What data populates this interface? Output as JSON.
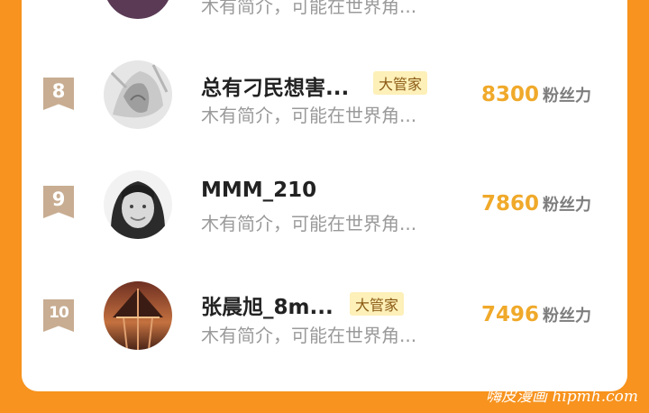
{
  "rows": [
    {
      "bio": "木有简介，可能在世界角..."
    },
    {
      "rank": "8",
      "name": "总有刁民想害...",
      "badge": "大管家",
      "bio": "木有简介，可能在世界角...",
      "fans": "8300",
      "fans_unit": "粉丝力",
      "avatar_icon": "grey-sketch-avatar"
    },
    {
      "rank": "9",
      "name": "MMM_210",
      "bio": "木有简介，可能在世界角...",
      "fans": "7860",
      "fans_unit": "粉丝力",
      "avatar_icon": "woman-photo-avatar"
    },
    {
      "rank": "10",
      "name": "张晨旭_8m...",
      "badge": "大管家",
      "bio": "木有简介，可能在世界角...",
      "fans": "7496",
      "fans_unit": "粉丝力",
      "avatar_icon": "tower-photo-avatar"
    }
  ],
  "watermark": "嗨皮漫画 hipmh.com",
  "colors": {
    "frame": "#f7931e",
    "score": "#f0a92a",
    "badge_bg": "#fdf0b8",
    "rank_badge": "#c8ad92"
  }
}
